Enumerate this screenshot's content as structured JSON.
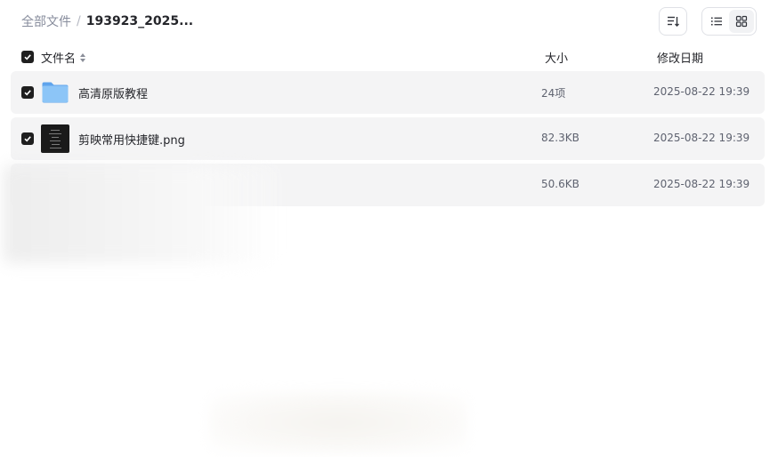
{
  "breadcrumb": {
    "root": "全部文件",
    "separator": "/",
    "current": "193923_2025..."
  },
  "toolbar": {
    "sort_icon": "sort-icon",
    "view_list_icon": "list-view-icon",
    "view_grid_icon": "grid-view-icon",
    "active_view": "list"
  },
  "table": {
    "columns": {
      "name": "文件名",
      "size": "大小",
      "date": "修改日期"
    },
    "rows": [
      {
        "icon": "folder-icon",
        "name": "高清原版教程",
        "size": "24项",
        "date": "2025-08-22 19:39",
        "checked": true
      },
      {
        "icon": "image-thumbnail",
        "name": "剪映常用快捷键.png",
        "size": "82.3KB",
        "date": "2025-08-22 19:39",
        "checked": true
      },
      {
        "icon": "",
        "name": "",
        "size": "50.6KB",
        "date": "2025-08-22 19:39",
        "checked": true
      }
    ]
  },
  "colors": {
    "row_bg": "#f4f4f5",
    "checkbox": "#1f1f1f",
    "folder": "#7cbaf5"
  }
}
